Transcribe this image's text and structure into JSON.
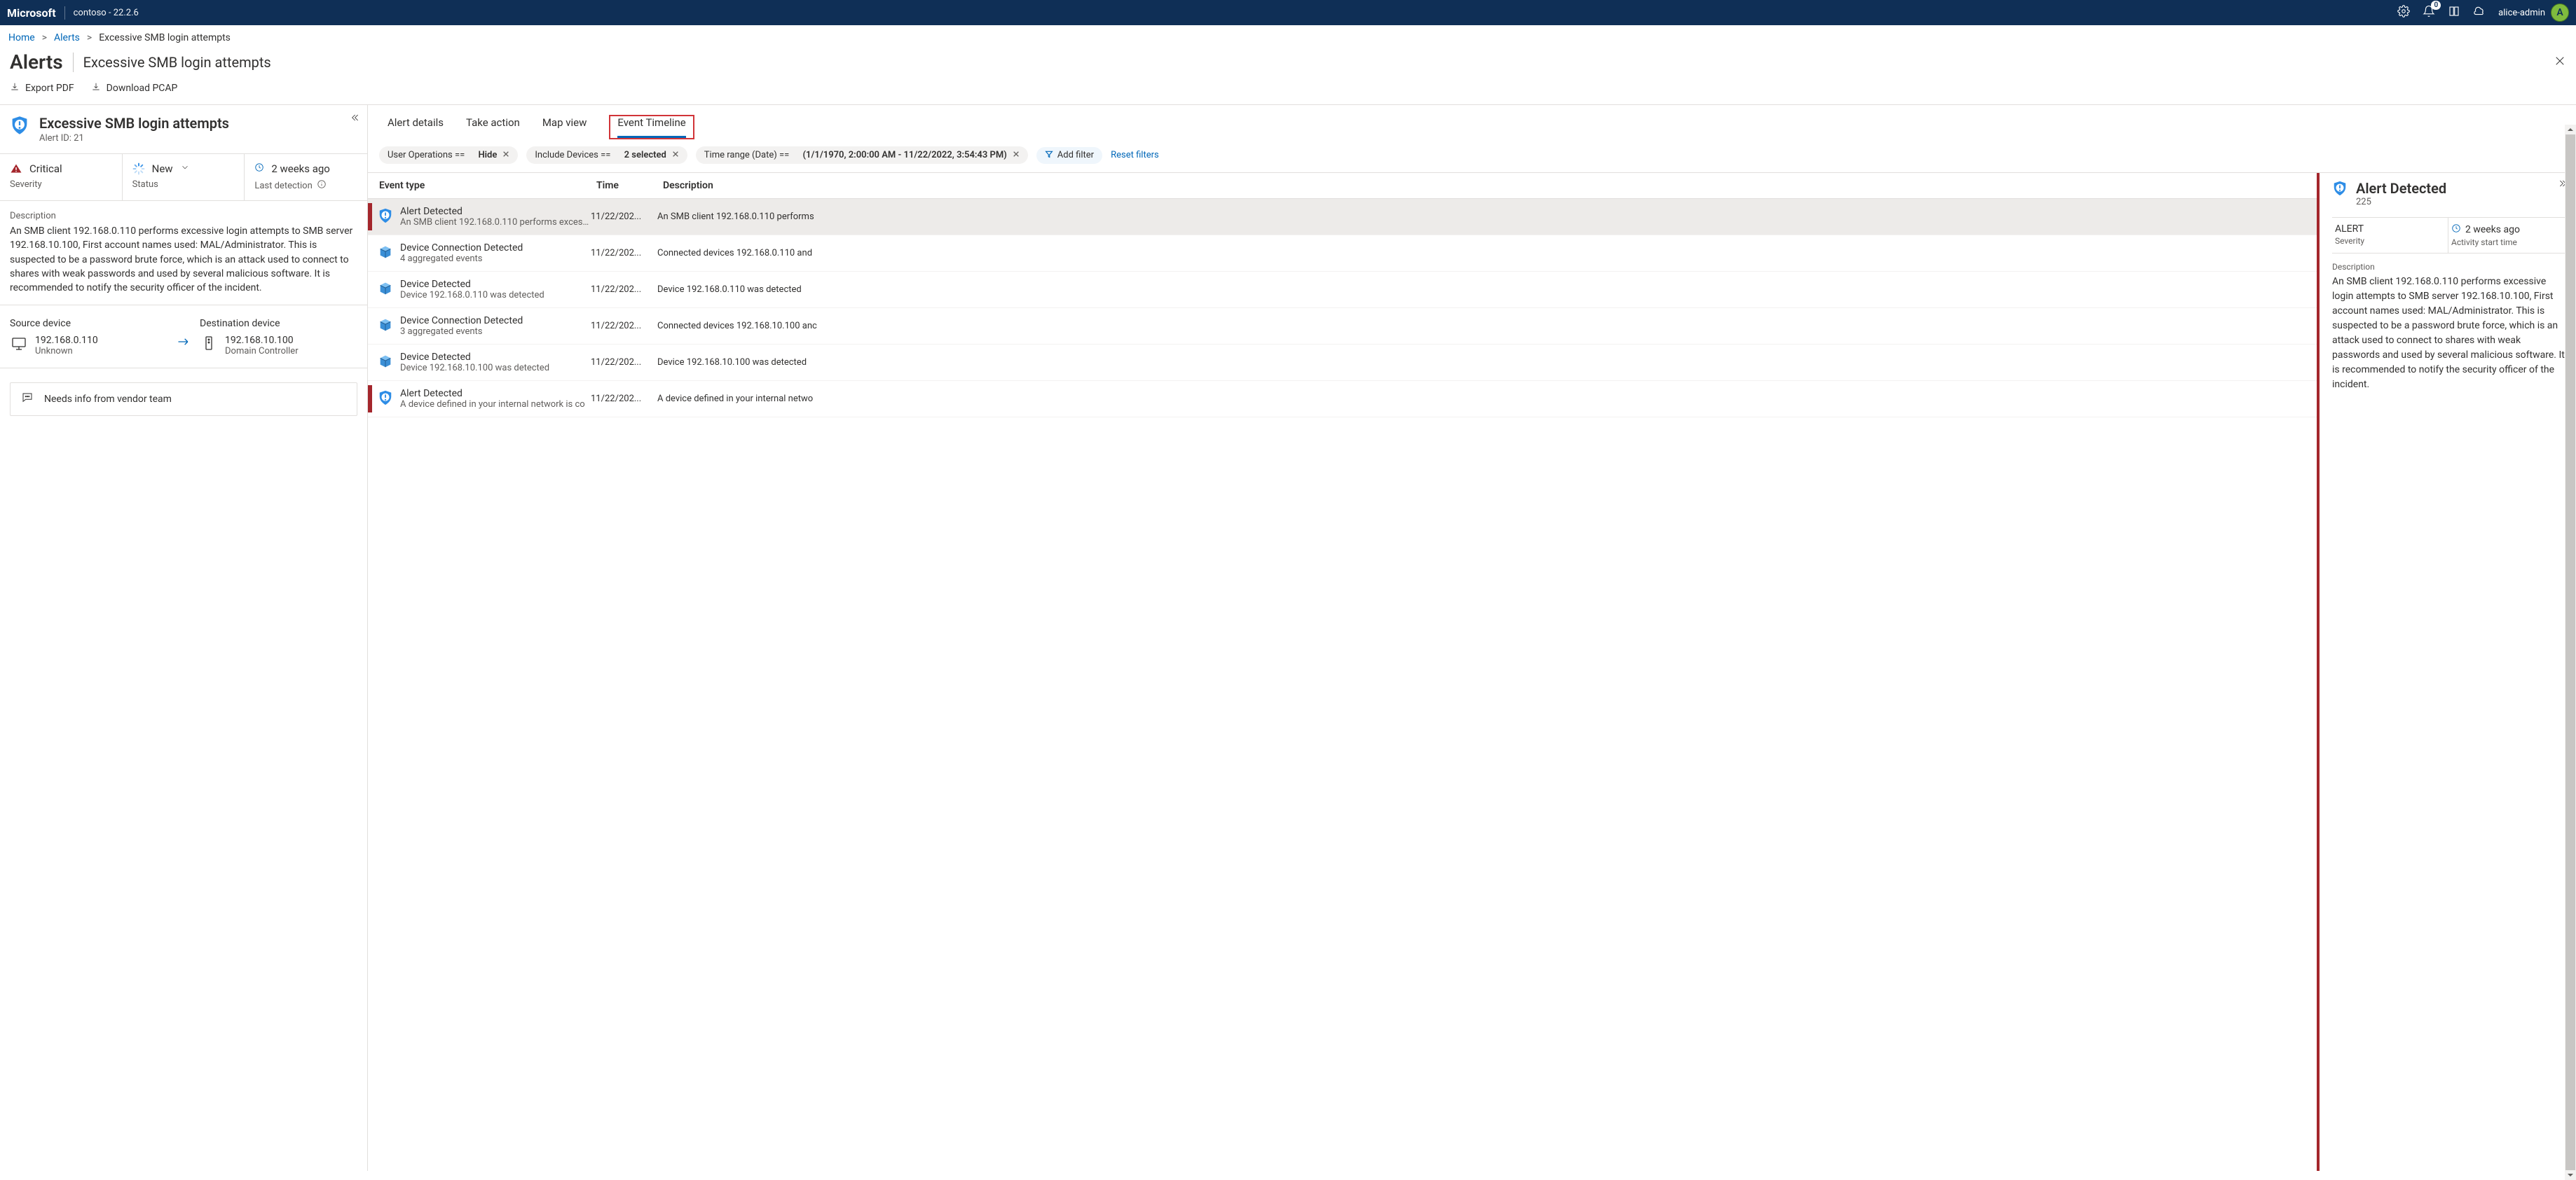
{
  "header": {
    "brand": "Microsoft",
    "tenant": "contoso - 22.2.6",
    "notification_count": "0",
    "user_name": "alice-admin",
    "user_initial": "A"
  },
  "breadcrumb": {
    "home": "Home",
    "alerts": "Alerts",
    "current": "Excessive SMB login attempts"
  },
  "page": {
    "title": "Alerts",
    "subtitle": "Excessive SMB login attempts"
  },
  "commands": {
    "export_pdf": "Export PDF",
    "download_pcap": "Download PCAP"
  },
  "hero": {
    "title": "Excessive SMB login attempts",
    "id_label": "Alert ID: 21"
  },
  "stats": {
    "severity_value": "Critical",
    "severity_label": "Severity",
    "status_value": "New",
    "status_label": "Status",
    "detection_value": "2 weeks ago",
    "detection_label": "Last detection"
  },
  "description": {
    "label": "Description",
    "text": "An SMB client 192.168.0.110 performs excessive login attempts to SMB server 192.168.10.100, First account names used: MAL/Administrator. This is suspected to be a password brute force, which is an attack used to connect to shares with weak passwords and used by several malicious software. It is recommended to notify the security officer of the incident."
  },
  "devices": {
    "src_label": "Source device",
    "src_ip": "192.168.0.110",
    "src_type": "Unknown",
    "dst_label": "Destination device",
    "dst_ip": "192.168.10.100",
    "dst_type": "Domain Controller"
  },
  "note": {
    "text": "Needs info from vendor team"
  },
  "tabs": {
    "t0": "Alert details",
    "t1": "Take action",
    "t2": "Map view",
    "t3": "Event Timeline"
  },
  "filters": {
    "f0_label": "User Operations ==",
    "f0_value": "Hide",
    "f1_label": "Include Devices ==",
    "f1_value": "2 selected",
    "f2_label": "Time range (Date)  ==",
    "f2_value": "(1/1/1970, 2:00:00 AM - 11/22/2022, 3:54:43 PM)",
    "add": "Add filter",
    "reset": "Reset filters"
  },
  "table": {
    "h_type": "Event type",
    "h_time": "Time",
    "h_desc": "Description",
    "rows": [
      {
        "kind": "alert",
        "title": "Alert Detected",
        "sub": "An SMB client 192.168.0.110 performs excessiv",
        "time": "11/22/202...",
        "desc": "An SMB client 192.168.0.110 performs",
        "selected": true
      },
      {
        "kind": "conn",
        "title": "Device Connection Detected",
        "sub": "4 aggregated events",
        "time": "11/22/202...",
        "desc": "Connected devices 192.168.0.110 and "
      },
      {
        "kind": "dev",
        "title": "Device Detected",
        "sub": "Device 192.168.0.110 was detected",
        "time": "11/22/202...",
        "desc": "Device 192.168.0.110 was detected"
      },
      {
        "kind": "conn",
        "title": "Device Connection Detected",
        "sub": "3 aggregated events",
        "time": "11/22/202...",
        "desc": "Connected devices 192.168.10.100 anc"
      },
      {
        "kind": "dev",
        "title": "Device Detected",
        "sub": "Device 192.168.10.100 was detected",
        "time": "11/22/202...",
        "desc": "Device 192.168.10.100 was detected"
      },
      {
        "kind": "alert",
        "title": "Alert Detected",
        "sub": "A device defined in your internal network is co",
        "time": "11/22/202...",
        "desc": "A device defined in your internal netwo"
      }
    ]
  },
  "detail": {
    "title": "Alert Detected",
    "id": "225",
    "sev_value": "ALERT",
    "sev_label": "Severity",
    "start_value": "2 weeks ago",
    "start_label": "Activity start time",
    "desc_label": "Description",
    "desc_text": "An SMB client 192.168.0.110 performs excessive login attempts to SMB server 192.168.10.100, First account names used: MAL/Administrator. This is suspected to be a password brute force, which is an attack used to connect to shares with weak passwords and used by several malicious software. It is recommended to notify the security officer of the incident."
  }
}
